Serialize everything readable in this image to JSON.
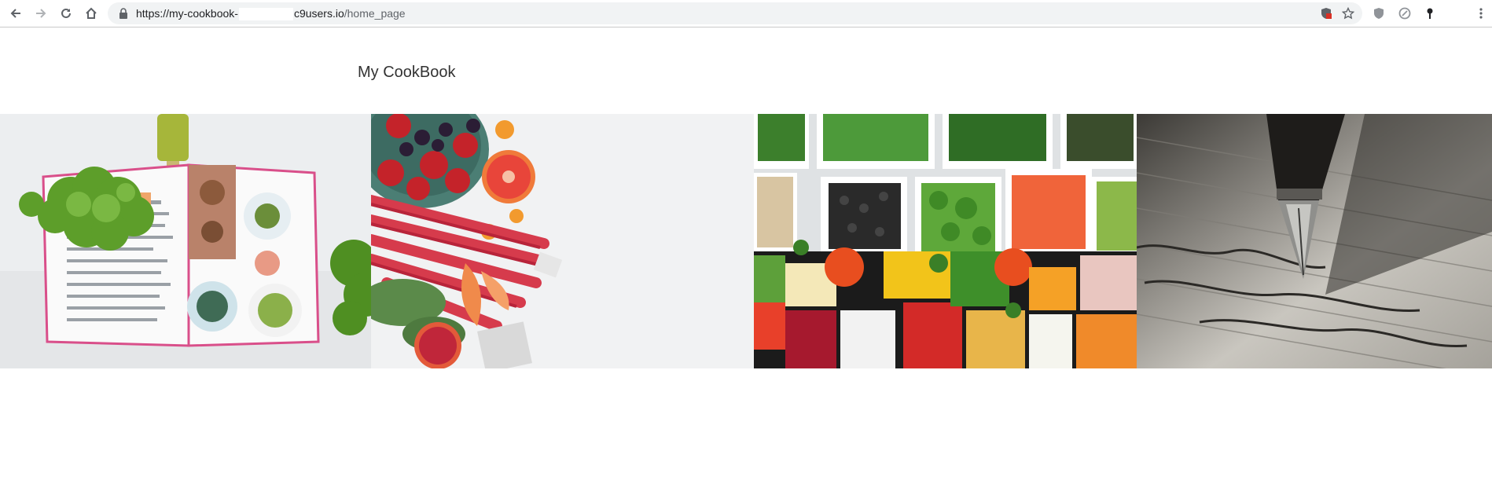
{
  "browser": {
    "url_prefix": "https://my-cookbook-",
    "url_domain": "c9users.io",
    "url_path": "/home_page",
    "icons": [
      "back-icon",
      "forward-icon",
      "reload-icon",
      "home-icon",
      "lock-icon",
      "shield-icon",
      "star-icon",
      "extension-icon",
      "menu-icon"
    ]
  },
  "page": {
    "site_title": "My CookBook",
    "hero_images": [
      {
        "name": "cookbook-photo"
      },
      {
        "name": "fruit-photo"
      },
      {
        "name": "salad-bar-photo"
      },
      {
        "name": "fountain-pen-photo"
      }
    ]
  }
}
